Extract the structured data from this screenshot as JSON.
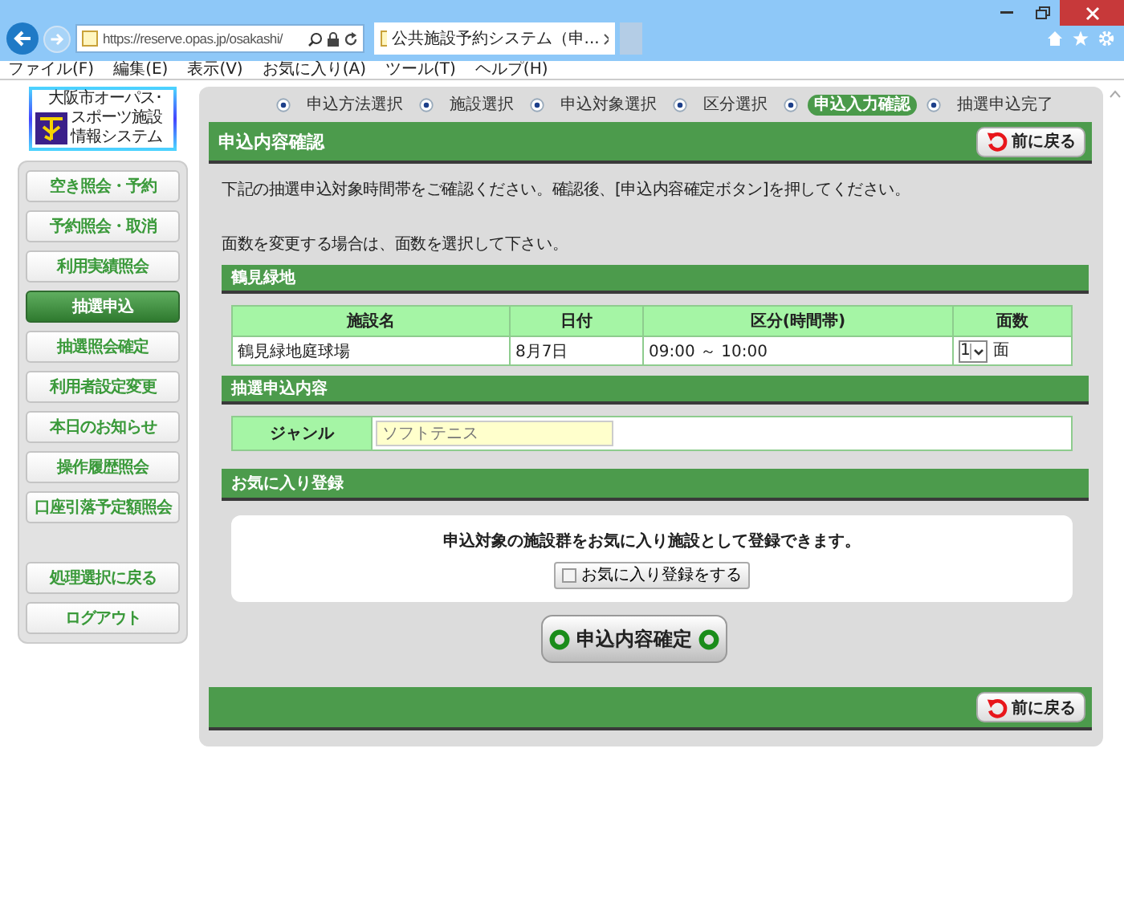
{
  "browser": {
    "url": "https://reserve.opas.jp/osakashi/",
    "tab_title": "公共施設予約システム（申...",
    "menu": [
      "ファイル(F)",
      "編集(E)",
      "表示(V)",
      "お気に入り(A)",
      "ツール(T)",
      "ヘルプ(H)"
    ]
  },
  "logo": {
    "lines": [
      "大阪市オーパス･",
      "スポーツ施設",
      "情報システム"
    ]
  },
  "sidebar": {
    "items": [
      {
        "label": "空き照会・予約",
        "selected": false
      },
      {
        "label": "予約照会・取消",
        "selected": false
      },
      {
        "label": "利用実績照会",
        "selected": false
      },
      {
        "label": "抽選申込",
        "selected": true
      },
      {
        "label": "抽選照会確定",
        "selected": false
      },
      {
        "label": "利用者設定変更",
        "selected": false
      },
      {
        "label": "本日のお知らせ",
        "selected": false
      },
      {
        "label": "操作履歴照会",
        "selected": false
      },
      {
        "label": "口座引落予定額照会",
        "selected": false
      }
    ],
    "bottom_items": [
      {
        "label": "処理選択に戻る"
      },
      {
        "label": "ログアウト"
      }
    ]
  },
  "steps": [
    {
      "label": "申込方法選択",
      "selected": false
    },
    {
      "label": "施設選択",
      "selected": false
    },
    {
      "label": "申込対象選択",
      "selected": false
    },
    {
      "label": "区分選択",
      "selected": false
    },
    {
      "label": "申込入力確認",
      "selected": true
    },
    {
      "label": "抽選申込完了",
      "selected": false
    }
  ],
  "page_title": "申込内容確認",
  "back_button": "前に戻る",
  "instructions": [
    "下記の抽選申込対象時間帯をご確認ください。確認後、[申込内容確定ボタン]を押してください。",
    "面数を変更する場合は、面数を選択して下さい。"
  ],
  "facility_section": {
    "title": "鶴見緑地",
    "table": {
      "columns": [
        "施設名",
        "日付",
        "区分(時間帯)",
        "面数"
      ],
      "rows": [
        {
          "facility": "鶴見緑地庭球場",
          "date": "8月7日",
          "slot": "09:00 ～ 10:00",
          "courts": "1",
          "unit": "面"
        }
      ]
    }
  },
  "content_section": {
    "title": "抽選申込内容",
    "genre_label": "ジャンル",
    "genre_value": "ソフトテニス"
  },
  "favorites_section": {
    "title": "お気に入り登録",
    "message": "申込対象の施設群をお気に入り施設として登録できます。",
    "checkbox": {
      "label": "お気に入り登録をする",
      "checked": false
    }
  },
  "confirm_button": "申込内容確定",
  "bottom_back_button": "前に戻る"
}
